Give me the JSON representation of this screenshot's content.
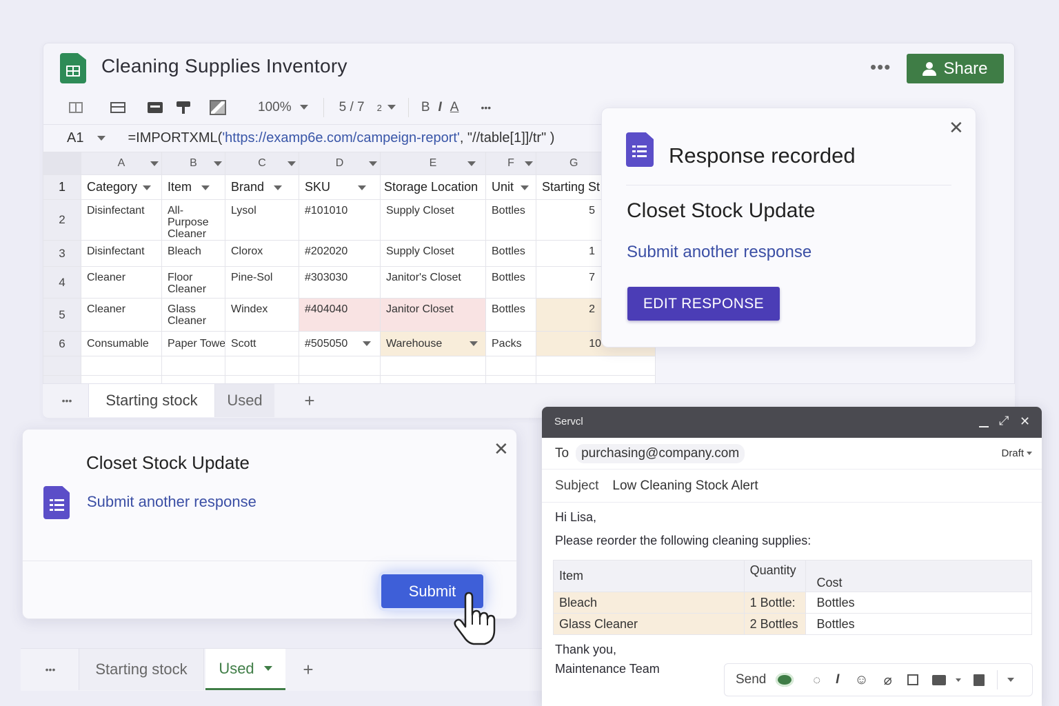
{
  "sheet": {
    "title": "Cleaning Supplies Inventory",
    "share_label": "Share",
    "zoom": "100%",
    "font_size": "5 / 7",
    "font_size_small": "2",
    "toolbar": {
      "bold": "B",
      "italic": "I",
      "text_color": "A",
      "more": "•••"
    },
    "cell_ref": "A1",
    "formula_prefix": "=IMPORTXML(",
    "formula_url": "'https://examp6e.com/campeign-report'",
    "formula_suffix": ", \"//table[1]]/tr\" )",
    "columns": [
      "A",
      "B",
      "C",
      "D",
      "E",
      "F",
      "G"
    ],
    "headers": [
      "Category",
      "Item",
      "Brand",
      "SKU",
      "Storage Location",
      "Unit",
      "Starting St"
    ],
    "rows": [
      {
        "num": "1"
      },
      {
        "num": "2",
        "cells": [
          "Disinfectant",
          "All-Purpose Cleaner",
          "Lysol",
          "#101010",
          "Supply Closet",
          "Bottles",
          "5"
        ]
      },
      {
        "num": "3",
        "cells": [
          "Disinfectant",
          "Bleach",
          "Clorox",
          "#202020",
          "Supply Closet",
          "Bottles",
          "1"
        ]
      },
      {
        "num": "4",
        "cells": [
          "Cleaner",
          "Floor Cleaner",
          "Pine-Sol",
          "#303030",
          "Janitor's Closet",
          "Bottles",
          "7"
        ]
      },
      {
        "num": "5",
        "cells": [
          "Cleaner",
          "Glass Cleaner",
          "Windex",
          "#404040",
          "Janitor Closet",
          "Bottles",
          "2"
        ]
      },
      {
        "num": "6",
        "cells": [
          "Consumable",
          "Paper Towel",
          "Scott",
          "#505050",
          "Warehouse",
          "Packs",
          "10"
        ]
      }
    ],
    "tabs": [
      "Starting stock",
      "Used"
    ],
    "add_tab": "+",
    "tab_menu": "•••"
  },
  "response_card": {
    "heading": "Response recorded",
    "form_title": "Closet Stock Update",
    "link": "Submit another response",
    "button": "EDIT RESPONSE"
  },
  "form_card": {
    "form_title": "Closet Stock Update",
    "link": "Submit another response",
    "submit": "Submit",
    "tabs": [
      "Starting stock",
      "Used"
    ],
    "add_tab": "+",
    "tab_menu": "•••"
  },
  "email": {
    "window_title": "Servcl",
    "to_label": "To",
    "to": "purchasing@company.com",
    "draft": "Draft",
    "subject_label": "Subject",
    "subject": "Low Cleaning Stock Alert",
    "greeting": "Hi Lisa,",
    "intro": "Please reorder the following cleaning supplies:",
    "table_headers": [
      "Item",
      "Quantity",
      "Cost"
    ],
    "table_rows": [
      [
        "Bleach",
        "1 Bottle:",
        "Bottles"
      ],
      [
        "Glass Cleaner",
        "2 Bottles",
        "Bottles"
      ]
    ],
    "signoff": "Thank you,",
    "signature": "Maintenance Team",
    "send": "Send"
  },
  "colors": {
    "sheets_green": "#2e8b57",
    "share_green": "#3f7d46",
    "forms_purple": "#5b4ec8",
    "edit_button": "#4b3db6",
    "submit_button": "#3e5fd8",
    "pink_highlight": "#f9e3e3",
    "peach_highlight": "#f8edda"
  }
}
